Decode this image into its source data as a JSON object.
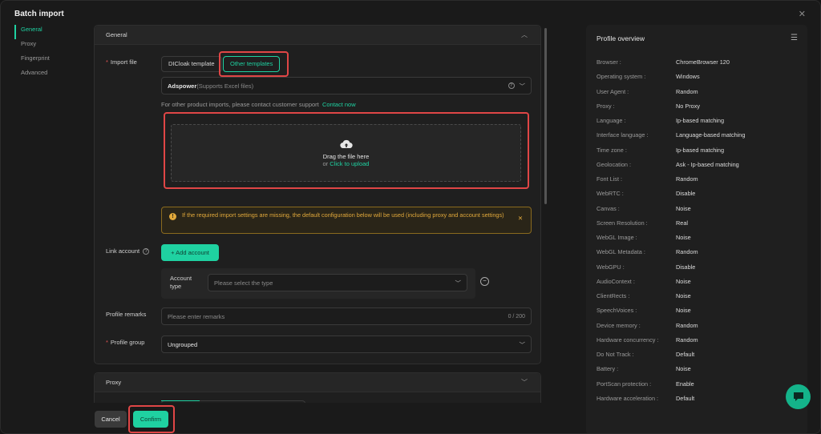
{
  "window": {
    "title": "Batch import"
  },
  "nav": [
    "General",
    "Proxy",
    "Fingerprint",
    "Advanced"
  ],
  "general": {
    "header": "General",
    "import_file_label": "Import file",
    "tpl_dicloak": "DICloak template",
    "tpl_other": "Other templates",
    "source_name": "Adspower",
    "source_hint": "(Supports Excel files)",
    "other_note": "For other product imports, please contact customer support",
    "contact_link": "Contact now",
    "drop_text": "Drag the file here",
    "drop_or": "or",
    "drop_link": "Click to upload",
    "warning": "If the required import settings are missing, the default configuration below will be used (including proxy and account settings)",
    "link_account_label": "Link account",
    "add_account": "Add account",
    "account_type_label": "Account type",
    "account_type_placeholder": "Please select the type",
    "remarks_label": "Profile remarks",
    "remarks_placeholder": "Please enter remarks",
    "remarks_count": "0 / 200",
    "group_label": "Profile group",
    "group_value": "Ungrouped"
  },
  "proxy_section": {
    "header": "Proxy"
  },
  "footer": {
    "cancel": "Cancel",
    "confirm": "Confirm"
  },
  "overview": {
    "title": "Profile overview",
    "items": [
      {
        "k": "Browser :",
        "v": "ChromeBrowser 120"
      },
      {
        "k": "Operating system :",
        "v": "Windows"
      },
      {
        "k": "User Agent :",
        "v": "Random"
      },
      {
        "k": "Proxy :",
        "v": "No Proxy"
      },
      {
        "k": "Language :",
        "v": "Ip-based matching"
      },
      {
        "k": "Interface language :",
        "v": "Language-based matching"
      },
      {
        "k": "Time zone :",
        "v": "Ip-based matching"
      },
      {
        "k": "Geolocation :",
        "v": "Ask - Ip-based matching"
      },
      {
        "k": "Font List :",
        "v": "Random"
      },
      {
        "k": "WebRTC :",
        "v": "Disable"
      },
      {
        "k": "Canvas :",
        "v": "Noise"
      },
      {
        "k": "Screen Resolution :",
        "v": "Real"
      },
      {
        "k": "WebGL Image :",
        "v": "Noise"
      },
      {
        "k": "WebGL Metadata :",
        "v": "Random"
      },
      {
        "k": "WebGPU :",
        "v": "Disable"
      },
      {
        "k": "AudioContext :",
        "v": "Noise"
      },
      {
        "k": "ClientRects :",
        "v": "Noise"
      },
      {
        "k": "SpeechVoices :",
        "v": "Noise"
      },
      {
        "k": "Device memory :",
        "v": "Random"
      },
      {
        "k": "Hardware concurrency :",
        "v": "Random"
      },
      {
        "k": "Do Not Track :",
        "v": "Default"
      },
      {
        "k": "Battery :",
        "v": "Noise"
      },
      {
        "k": "PortScan protection :",
        "v": "Enable"
      },
      {
        "k": "Hardware acceleration :",
        "v": "Default"
      }
    ]
  },
  "colors": {
    "accent": "#1fd1a1",
    "highlight": "#e04646",
    "warning": "#e2a93b"
  }
}
